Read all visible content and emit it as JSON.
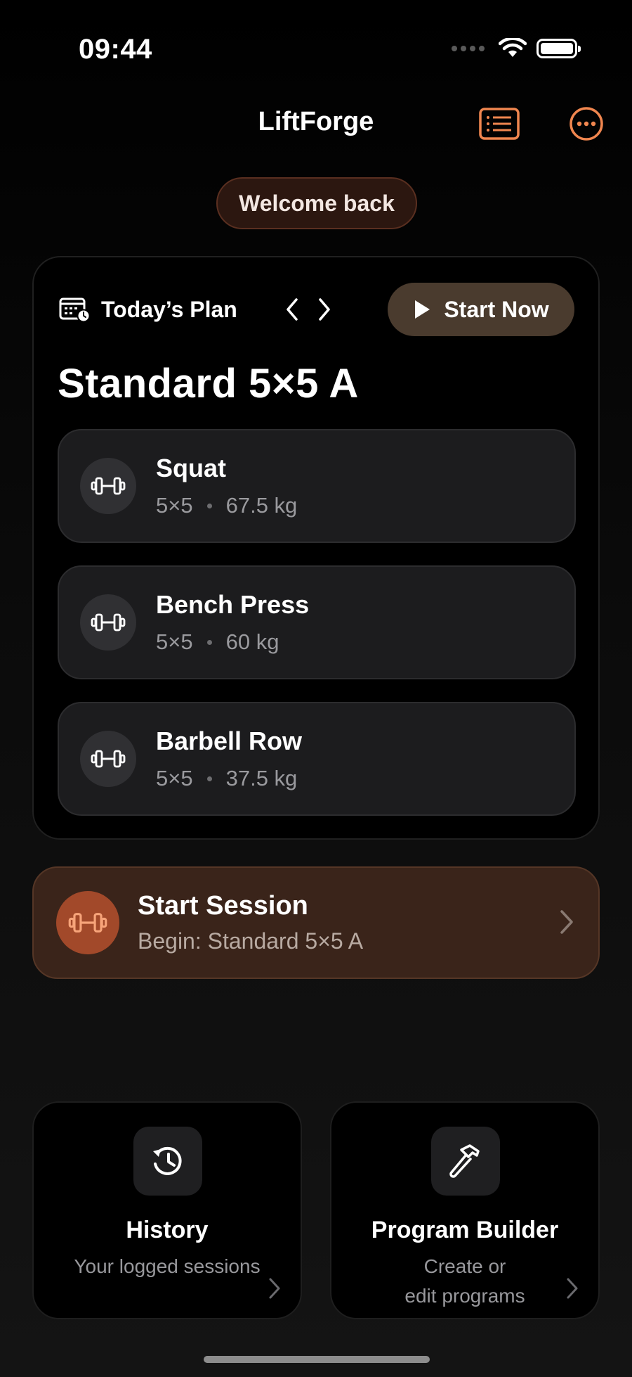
{
  "status_bar": {
    "time": "09:44"
  },
  "nav": {
    "title": "LiftForge"
  },
  "welcome": {
    "text": "Welcome back"
  },
  "plan": {
    "label": "Today’s Plan",
    "start_button": "Start Now",
    "title": "Standard 5×5 A",
    "exercises": [
      {
        "name": "Squat",
        "scheme": "5×5",
        "weight": "67.5 kg"
      },
      {
        "name": "Bench Press",
        "scheme": "5×5",
        "weight": "60 kg"
      },
      {
        "name": "Barbell Row",
        "scheme": "5×5",
        "weight": "37.5 kg"
      }
    ]
  },
  "session": {
    "title": "Start Session",
    "subtitle": "Begin: Standard 5×5 A"
  },
  "tiles": {
    "history": {
      "title": "History",
      "subtitle": "Your logged sessions"
    },
    "builder": {
      "title": "Program Builder",
      "subtitle_line1": "Create or",
      "subtitle_line2": "edit programs"
    }
  },
  "colors": {
    "accent": "#f0864f",
    "background": "#000000",
    "card": "#1c1c1e",
    "session_bg": "#3a241a"
  },
  "icons": {
    "nav_list": "list-icon",
    "nav_more": "more-icon",
    "plan": "calendar-icon",
    "exercise": "dumbbell-icon",
    "history": "history-icon",
    "builder": "hammer-icon"
  }
}
